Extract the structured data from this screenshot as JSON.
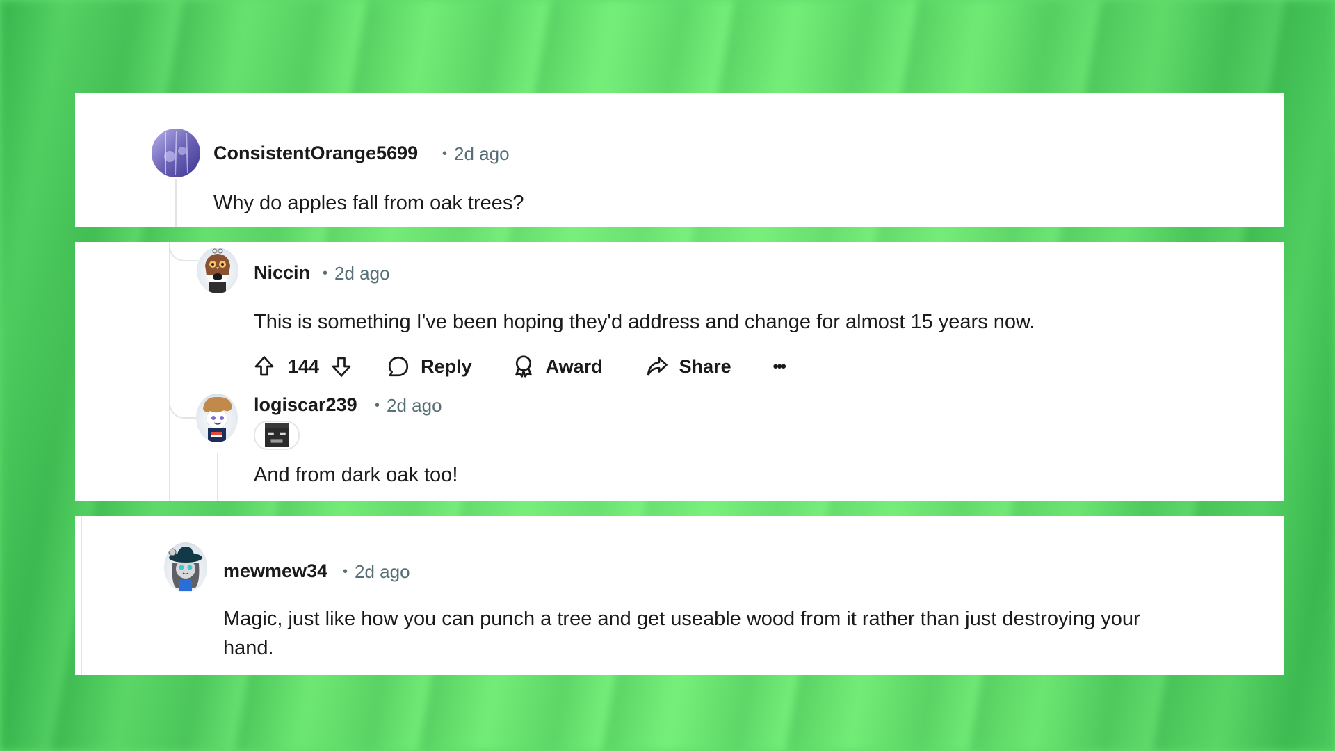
{
  "background": {
    "accent": "#5fdc6c"
  },
  "comments": [
    {
      "username": "ConsistentOrange5699",
      "time": "2d ago",
      "separator": "•",
      "avatar_icon": "purple-forest-avatar",
      "body": "Why do apples fall from oak trees?"
    },
    {
      "username": "Niccin",
      "time": "2d ago",
      "separator": "•",
      "avatar_icon": "owl-snoo-avatar",
      "body": "This is something I've been hoping they'd address and change for almost 15 years now.",
      "actions": {
        "score": "144",
        "upvote_icon": "upvote-arrow-icon",
        "downvote_icon": "downvote-arrow-icon",
        "reply_label": "Reply",
        "award_label": "Award",
        "share_label": "Share",
        "more_label": "•••"
      }
    },
    {
      "username": "logiscar239",
      "time": "2d ago",
      "separator": "•",
      "avatar_icon": "curly-hair-snoo-avatar",
      "flair_icon": "wither-skull-flair",
      "body": "And from dark oak too!"
    },
    {
      "username": "mewmew34",
      "time": "2d ago",
      "separator": "•",
      "avatar_icon": "cat-hat-snoo-avatar",
      "body_lines": [
        "Magic, just like how you can punch a tree and get useable wood from it rather than just destroying your",
        "hand."
      ]
    }
  ]
}
